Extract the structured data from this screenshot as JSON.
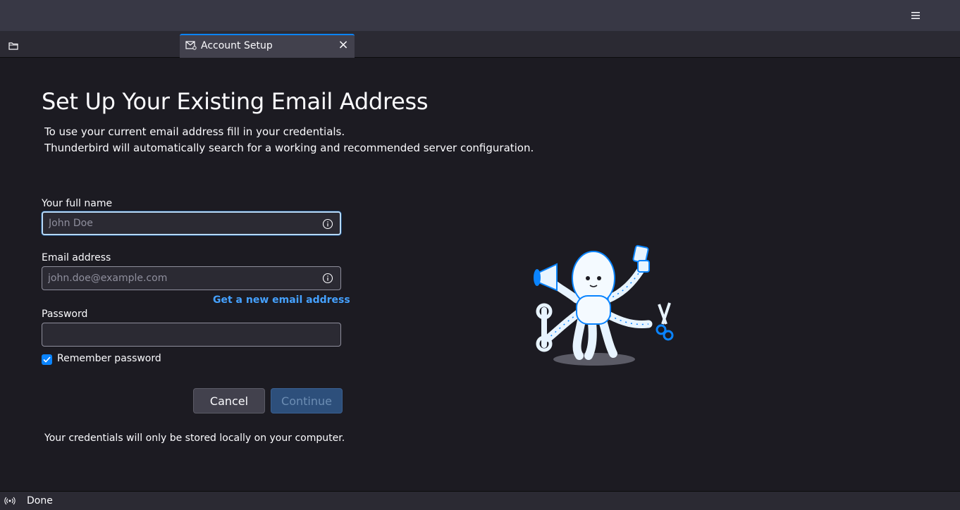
{
  "window": {
    "menu_icon": "hamburger-menu-icon"
  },
  "tabs": {
    "folder_icon": "folder-icon",
    "active": {
      "icon": "account-setup-icon",
      "label": "Account Setup",
      "close_icon": "close-icon",
      "close_glyph": "×"
    }
  },
  "setup": {
    "title": "Set Up Your Existing Email Address",
    "subtitle_line1": "To use your current email address fill in your credentials.",
    "subtitle_line2": "Thunderbird will automatically search for a working and recommended server configuration.",
    "full_name": {
      "label": "Your full name",
      "placeholder": "John Doe",
      "value": ""
    },
    "email": {
      "label": "Email address",
      "placeholder": "john.doe@example.com",
      "value": ""
    },
    "new_email_link": "Get a new email address",
    "password": {
      "label": "Password",
      "value": ""
    },
    "remember_password": {
      "label": "Remember password",
      "checked": true
    },
    "cancel_label": "Cancel",
    "continue_label": "Continue",
    "footnote": "Your credentials will only be stored locally on your computer.",
    "illustration": "octopus-mascot-illustration"
  },
  "status": {
    "icon": "connection-status-icon",
    "text": "Done"
  },
  "colors": {
    "accent": "#0a84ff",
    "link": "#45a1ff",
    "background": "#1c1b22"
  }
}
